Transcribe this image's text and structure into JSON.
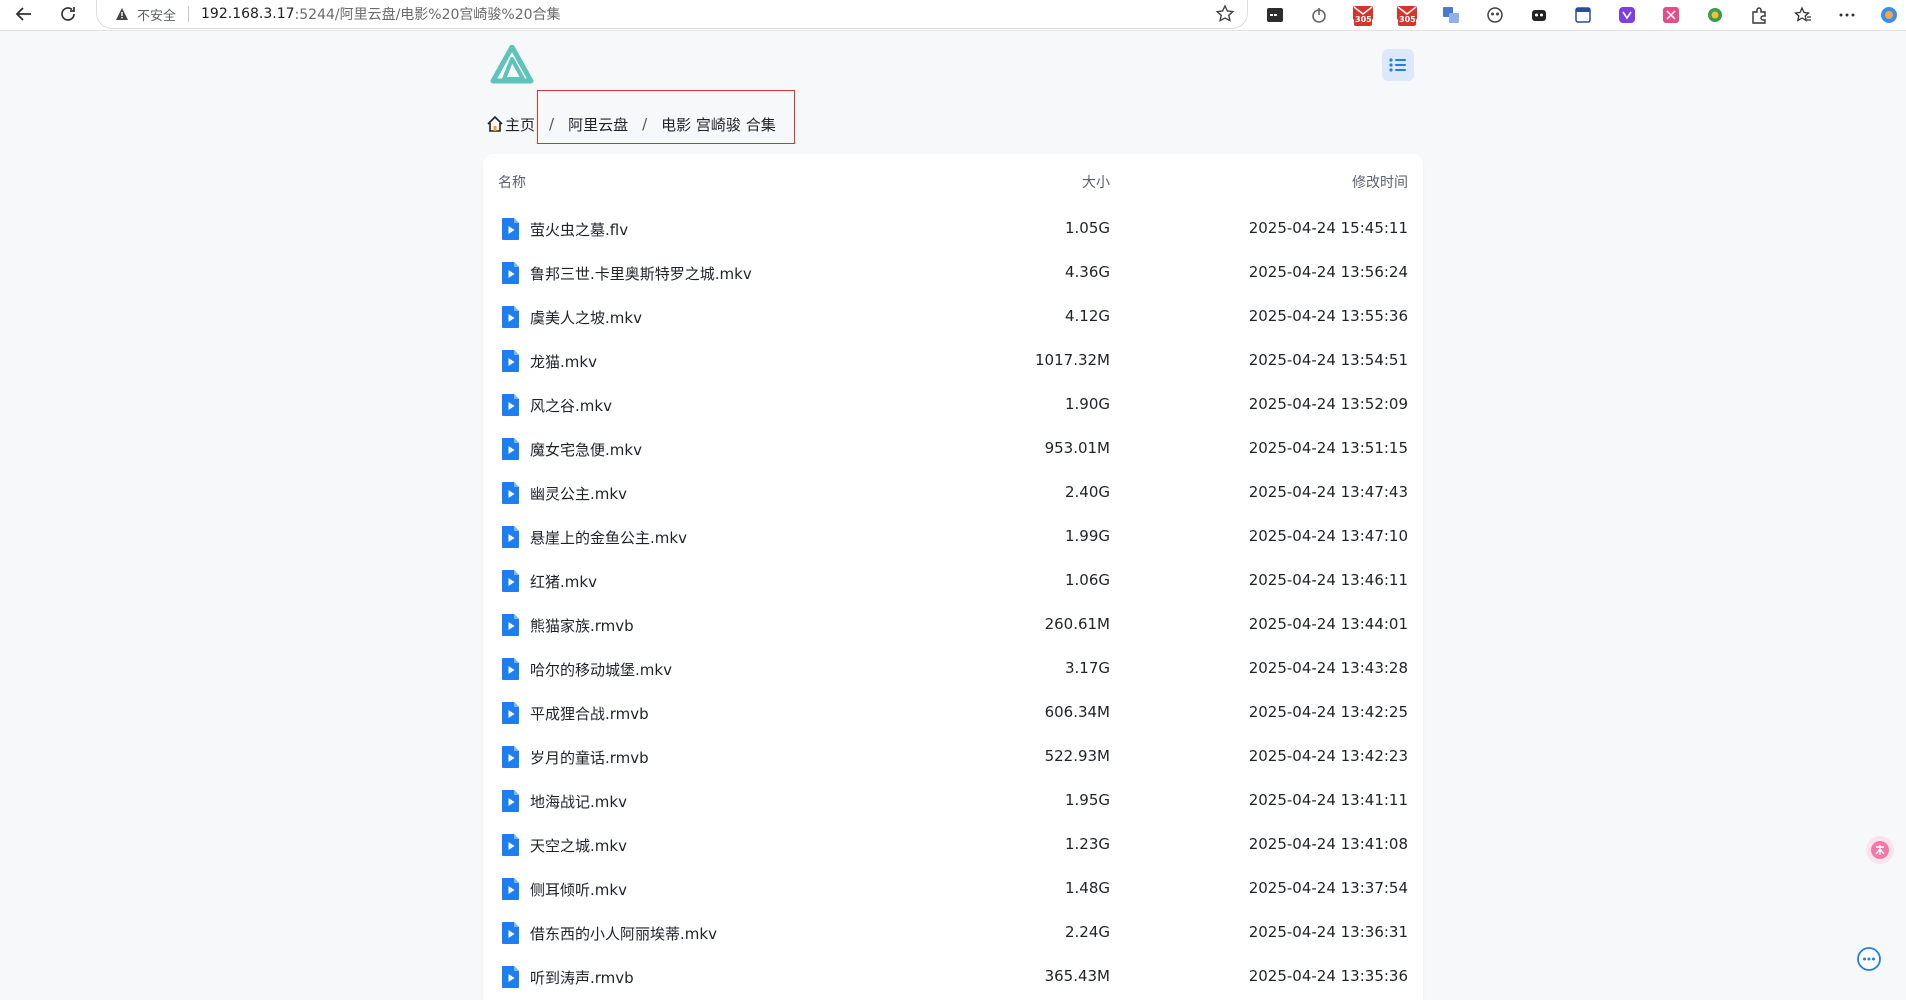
{
  "browser": {
    "security_label": "不安全",
    "url_host": "192.168.3.17",
    "url_path": ":5244/阿里云盘/电影%20宫崎骏%20合集",
    "badge_count_1": "305",
    "badge_count_2": "305"
  },
  "breadcrumb": {
    "items": [
      {
        "label": "主页"
      },
      {
        "label": "阿里云盘"
      },
      {
        "label": "电影 宫崎骏 合集"
      }
    ],
    "separator": "/"
  },
  "table": {
    "headers": {
      "name": "名称",
      "size": "大小",
      "modified": "修改时间"
    },
    "rows": [
      {
        "name": "萤火虫之墓.flv",
        "size": "1.05G",
        "modified": "2025-04-24 15:45:11"
      },
      {
        "name": "鲁邦三世.卡里奥斯特罗之城.mkv",
        "size": "4.36G",
        "modified": "2025-04-24 13:56:24"
      },
      {
        "name": "虞美人之坡.mkv",
        "size": "4.12G",
        "modified": "2025-04-24 13:55:36"
      },
      {
        "name": "龙猫.mkv",
        "size": "1017.32M",
        "modified": "2025-04-24 13:54:51"
      },
      {
        "name": "风之谷.mkv",
        "size": "1.90G",
        "modified": "2025-04-24 13:52:09"
      },
      {
        "name": "魔女宅急便.mkv",
        "size": "953.01M",
        "modified": "2025-04-24 13:51:15"
      },
      {
        "name": "幽灵公主.mkv",
        "size": "2.40G",
        "modified": "2025-04-24 13:47:43"
      },
      {
        "name": "悬崖上的金鱼公主.mkv",
        "size": "1.99G",
        "modified": "2025-04-24 13:47:10"
      },
      {
        "name": "红猪.mkv",
        "size": "1.06G",
        "modified": "2025-04-24 13:46:11"
      },
      {
        "name": "熊猫家族.rmvb",
        "size": "260.61M",
        "modified": "2025-04-24 13:44:01"
      },
      {
        "name": "哈尔的移动城堡.mkv",
        "size": "3.17G",
        "modified": "2025-04-24 13:43:28"
      },
      {
        "name": "平成狸合战.rmvb",
        "size": "606.34M",
        "modified": "2025-04-24 13:42:25"
      },
      {
        "name": "岁月的童话.rmvb",
        "size": "522.93M",
        "modified": "2025-04-24 13:42:23"
      },
      {
        "name": "地海战记.mkv",
        "size": "1.95G",
        "modified": "2025-04-24 13:41:11"
      },
      {
        "name": "天空之城.mkv",
        "size": "1.23G",
        "modified": "2025-04-24 13:41:08"
      },
      {
        "name": "侧耳倾听.mkv",
        "size": "1.48G",
        "modified": "2025-04-24 13:37:54"
      },
      {
        "name": "借东西的小人阿丽埃蒂.mkv",
        "size": "2.24G",
        "modified": "2025-04-24 13:36:31"
      },
      {
        "name": "听到涛声.rmvb",
        "size": "365.43M",
        "modified": "2025-04-24 13:35:36"
      }
    ]
  },
  "colors": {
    "accent": "#1c7ef0",
    "logo": "#5ec3b9",
    "highlight_box": "#d9342b"
  }
}
